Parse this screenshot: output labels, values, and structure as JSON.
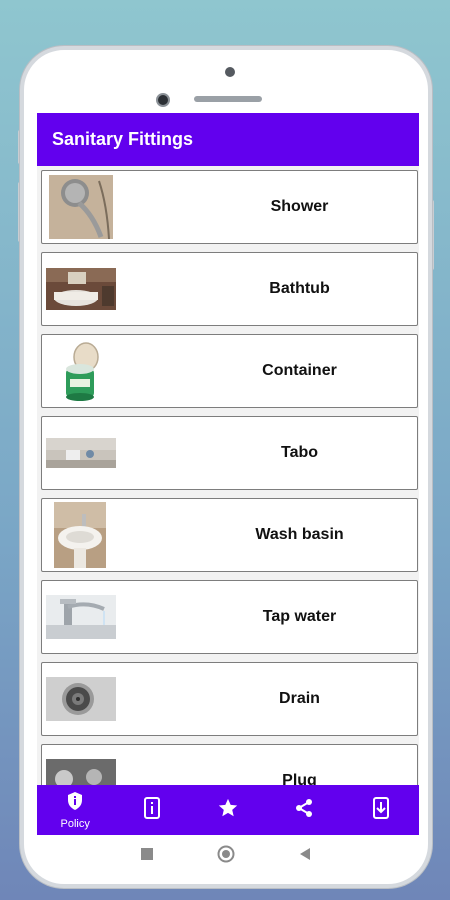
{
  "app": {
    "title": "Sanitary Fittings"
  },
  "items": [
    {
      "label": "Shower",
      "icon": "shower-photo"
    },
    {
      "label": "Bathtub",
      "icon": "bathtub-photo"
    },
    {
      "label": "Container",
      "icon": "container-photo"
    },
    {
      "label": "Tabo",
      "icon": "tabo-photo"
    },
    {
      "label": "Wash basin",
      "icon": "wash-basin-photo"
    },
    {
      "label": "Tap water",
      "icon": "tap-water-photo"
    },
    {
      "label": "Drain",
      "icon": "drain-photo"
    },
    {
      "label": "Plug",
      "icon": "plug-photo"
    }
  ],
  "bottom_nav": [
    {
      "label": "Policy",
      "icon": "shield-info-icon"
    },
    {
      "label": "",
      "icon": "info-icon"
    },
    {
      "label": "",
      "icon": "star-icon"
    },
    {
      "label": "",
      "icon": "share-icon"
    },
    {
      "label": "",
      "icon": "download-icon"
    }
  ],
  "colors": {
    "primary": "#6200ee",
    "background": "#f2f2f2"
  }
}
